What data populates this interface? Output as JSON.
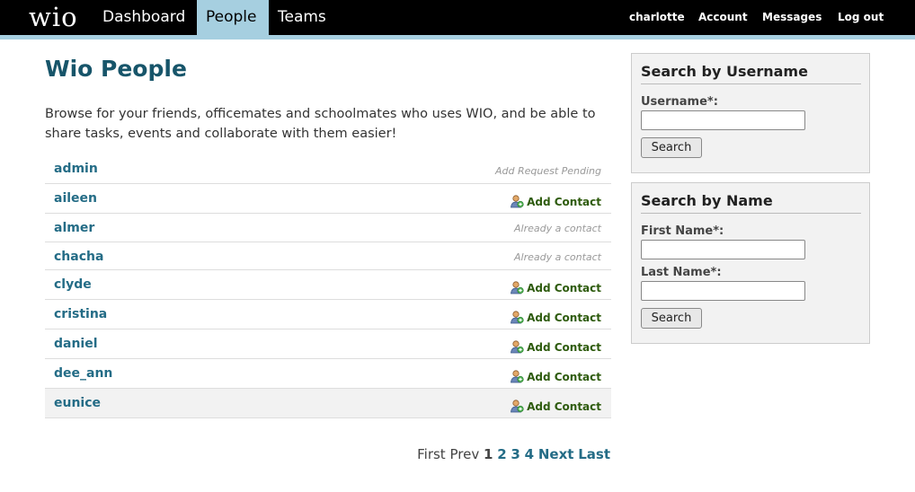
{
  "header": {
    "logo": "wio",
    "tabs": [
      {
        "label": "Dashboard",
        "active": false
      },
      {
        "label": "People",
        "active": true
      },
      {
        "label": "Teams",
        "active": false
      }
    ],
    "user_links": [
      {
        "label": "charlotte"
      },
      {
        "label": "Account"
      },
      {
        "label": "Messages"
      },
      {
        "label": "Log out"
      }
    ]
  },
  "main": {
    "title": "Wio People",
    "intro": "Browse for your friends, officemates and schoolmates who uses WIO, and be able to share tasks, events and collaborate with them easier!",
    "people": [
      {
        "name": "admin",
        "status": "Add Request Pending",
        "action": null
      },
      {
        "name": "aileen",
        "status": null,
        "action": "Add Contact"
      },
      {
        "name": "almer",
        "status": "Already a contact",
        "action": null
      },
      {
        "name": "chacha",
        "status": "Already a contact",
        "action": null
      },
      {
        "name": "clyde",
        "status": null,
        "action": "Add Contact"
      },
      {
        "name": "cristina",
        "status": null,
        "action": "Add Contact"
      },
      {
        "name": "daniel",
        "status": null,
        "action": "Add Contact"
      },
      {
        "name": "dee_ann",
        "status": null,
        "action": "Add Contact"
      },
      {
        "name": "eunice",
        "status": null,
        "action": "Add Contact"
      }
    ],
    "pager": {
      "first": "First",
      "prev": "Prev",
      "pages": [
        "1",
        "2",
        "3",
        "4"
      ],
      "current": "1",
      "next": "Next",
      "last": "Last"
    }
  },
  "sidebar": {
    "username_search": {
      "title": "Search by Username",
      "label": "Username*:",
      "value": "",
      "button": "Search"
    },
    "name_search": {
      "title": "Search by Name",
      "first_label": "First Name*:",
      "first_value": "",
      "last_label": "Last Name*:",
      "last_value": "",
      "button": "Search"
    }
  },
  "icons": {
    "add_contact": "add-user-icon"
  },
  "colors": {
    "topbar": "#000000",
    "accent": "#a6cfe0",
    "title": "#17556a",
    "link": "#246c86",
    "action": "#2e5b0e"
  }
}
